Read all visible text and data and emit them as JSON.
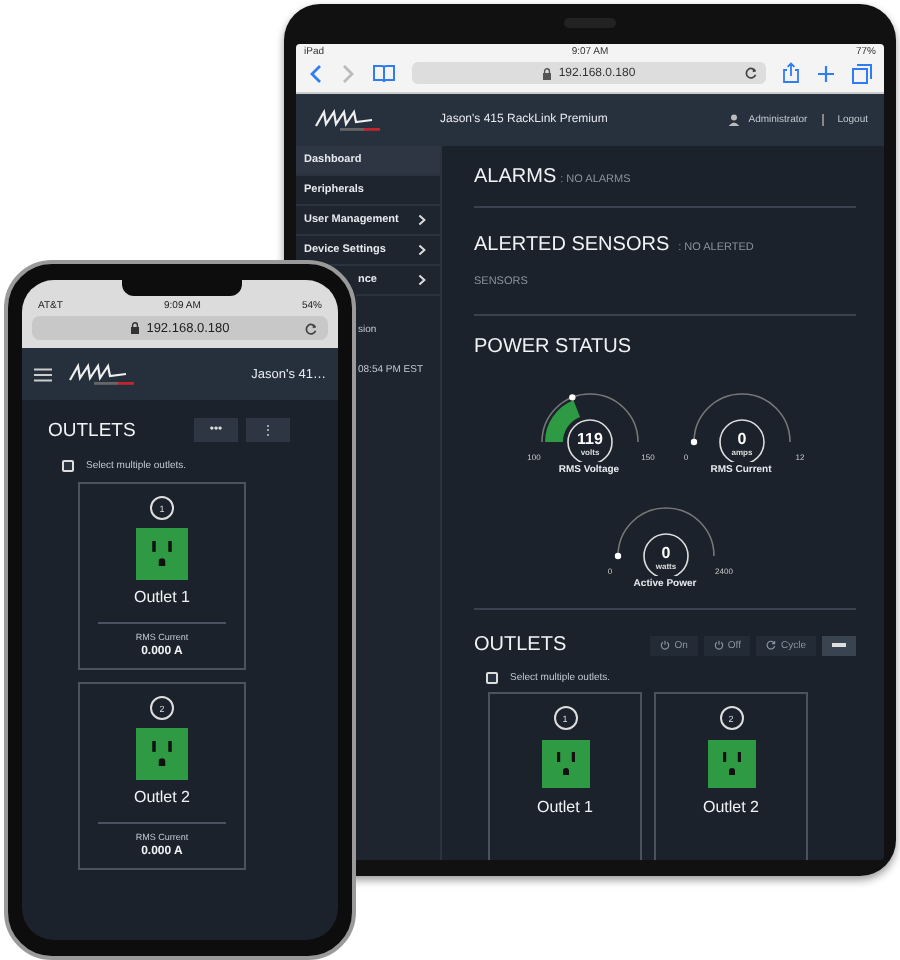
{
  "tablet": {
    "status_bar": {
      "carrier": "iPad",
      "time": "9:07 AM",
      "battery": "77%"
    },
    "browser": {
      "url": "192.168.0.180"
    },
    "header": {
      "title": "Jason's 415 RackLink Premium",
      "user": "Administrator",
      "logout": "Logout"
    },
    "sidebar": {
      "items": [
        {
          "label": "Dashboard",
          "selected": true,
          "expandable": false,
          "kind": "full"
        },
        {
          "label": "Peripherals",
          "selected": false,
          "expandable": false,
          "kind": "full"
        },
        {
          "label": "User Management",
          "selected": false,
          "expandable": true,
          "kind": "full"
        },
        {
          "label": "Device Settings",
          "selected": false,
          "expandable": true,
          "kind": "full"
        },
        {
          "label": "nce",
          "selected": false,
          "expandable": true,
          "kind": "partial"
        }
      ],
      "notes": [
        "sion",
        "08:54 PM EST"
      ]
    },
    "alarms": {
      "title": "ALARMS",
      "status": ": NO ALARMS"
    },
    "alerted_sensors": {
      "title": "ALERTED SENSORS",
      "status": ": NO ALERTED SENSORS"
    },
    "power_status": {
      "title": "POWER STATUS",
      "gauges": [
        {
          "value": "119",
          "unit": "volts",
          "min": "100",
          "max": "150",
          "label": "RMS Voltage",
          "level": 0.38
        },
        {
          "value": "0",
          "unit": "amps",
          "min": "0",
          "max": "12",
          "label": "RMS Current",
          "level": 0
        },
        {
          "value": "0",
          "unit": "watts",
          "min": "0",
          "max": "2400",
          "label": "Active Power",
          "level": 0
        }
      ]
    },
    "outlets": {
      "title": "OUTLETS",
      "actions": [
        {
          "label": "On",
          "kind": "power"
        },
        {
          "label": "Off",
          "kind": "power"
        },
        {
          "label": "Cycle",
          "kind": "cycle"
        },
        {
          "kind": "menu"
        }
      ],
      "select_multiple": {
        "label": "Select multiple outlets.",
        "checked": false
      },
      "items": [
        {
          "number": "1",
          "name": "Outlet 1",
          "on": true
        },
        {
          "number": "2",
          "name": "Outlet 2",
          "on": true
        }
      ]
    }
  },
  "phone": {
    "status_bar": {
      "carrier": "AT&T",
      "time": "9:09 AM",
      "battery": "54%"
    },
    "browser": {
      "url": "192.168.0.180"
    },
    "header": {
      "title": "Jason's 41…"
    },
    "outlets": {
      "title": "OUTLETS",
      "actions": [
        "•••",
        "⋮"
      ],
      "select_multiple": {
        "label": "Select multiple outlets.",
        "checked": false
      },
      "items": [
        {
          "number": "1",
          "name": "Outlet 1",
          "on": true,
          "current_label": "RMS Current",
          "current": "0.000 A"
        },
        {
          "number": "2",
          "name": "Outlet 2",
          "on": true,
          "current_label": "RMS Current",
          "current": "0.000 A"
        }
      ]
    }
  }
}
